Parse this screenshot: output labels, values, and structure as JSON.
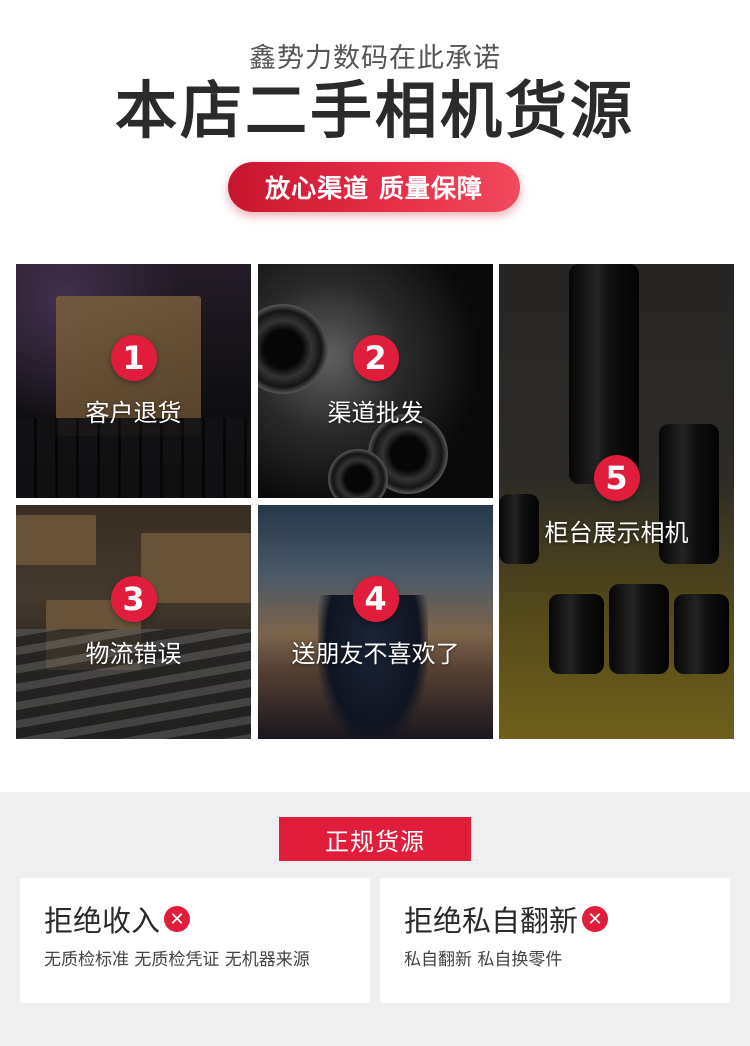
{
  "header": {
    "subtitle": "鑫势力数码在此承诺",
    "title": "本店二手相机货源",
    "pill": "放心渠道 质量保障"
  },
  "tiles": [
    {
      "num": "1",
      "label": "客户退货"
    },
    {
      "num": "2",
      "label": "渠道批发"
    },
    {
      "num": "3",
      "label": "物流错误"
    },
    {
      "num": "4",
      "label": "送朋友不喜欢了"
    },
    {
      "num": "5",
      "label": "柜台展示相机"
    }
  ],
  "bottom": {
    "badge": "正规货源",
    "cards": [
      {
        "title": "拒绝收入",
        "mark": "✕",
        "desc": "无质检标准  无质检凭证  无机器来源"
      },
      {
        "title": "拒绝私自翻新",
        "mark": "✕",
        "desc": "私自翻新  私自换零件"
      }
    ]
  },
  "colors": {
    "accent": "#e01e3c",
    "bottom_bg": "#efefef"
  }
}
